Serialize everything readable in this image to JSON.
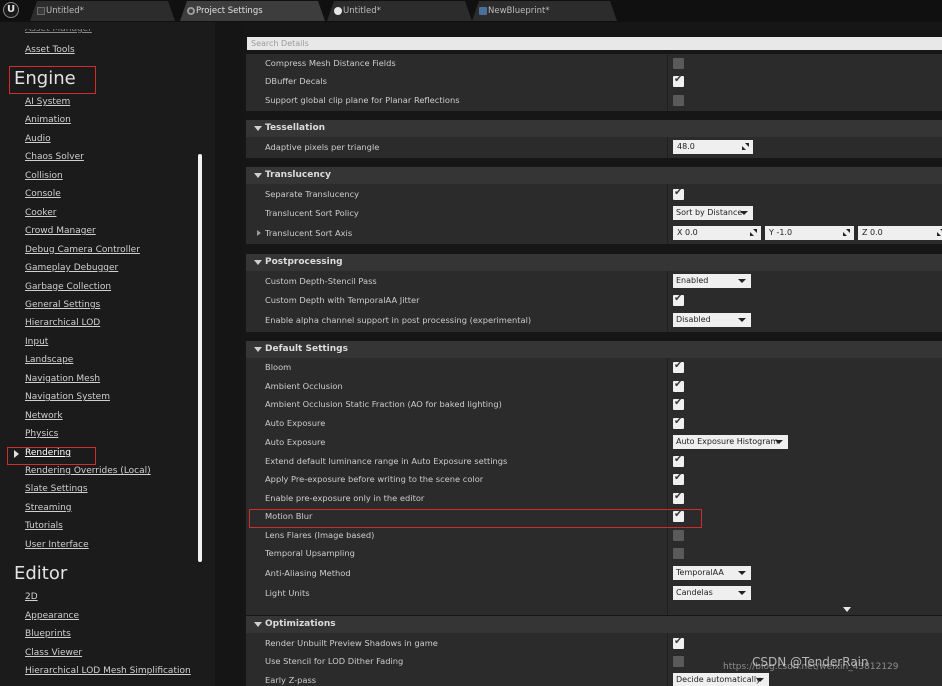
{
  "app": {
    "logo": "U",
    "tabs": [
      {
        "label": "Untitled*",
        "icon": "document-icon"
      },
      {
        "label": "Project Settings",
        "icon": "gear-icon"
      },
      {
        "label": "Untitled*",
        "icon": "level-icon"
      },
      {
        "label": "NewBlueprint*",
        "icon": "blueprint-icon"
      }
    ]
  },
  "sidebar": {
    "partial_top": "Asset Manager",
    "asset_tools": "Asset Tools",
    "engine_title": "Engine",
    "engine_items": [
      "AI System",
      "Animation",
      "Audio",
      "Chaos Solver",
      "Collision",
      "Console",
      "Cooker",
      "Crowd Manager",
      "Debug Camera Controller",
      "Gameplay Debugger",
      "Garbage Collection",
      "General Settings",
      "Hierarchical LOD",
      "Input",
      "Landscape",
      "Navigation Mesh",
      "Navigation System",
      "Network",
      "Physics",
      "Rendering",
      "Rendering Overrides (Local)",
      "Slate Settings",
      "Streaming",
      "Tutorials",
      "User Interface"
    ],
    "selected_item": "Rendering",
    "editor_title": "Editor",
    "editor_items": [
      "2D",
      "Appearance",
      "Blueprints",
      "Class Viewer",
      "Hierarchical LOD Mesh Simplification"
    ]
  },
  "details": {
    "search_placeholder": "Search Details",
    "top_rows": [
      {
        "label": "Compress Mesh Distance Fields",
        "checked": false
      },
      {
        "label": "DBuffer Decals",
        "checked": true
      },
      {
        "label": "Support global clip plane for Planar Reflections",
        "checked": false
      }
    ],
    "tessellation": {
      "title": "Tessellation",
      "adaptive_label": "Adaptive pixels per triangle",
      "adaptive_value": "48.0"
    },
    "translucency": {
      "title": "Translucency",
      "separate_label": "Separate Translucency",
      "separate_checked": true,
      "sort_policy_label": "Translucent Sort Policy",
      "sort_policy_value": "Sort by Distance",
      "sort_axis_label": "Translucent Sort Axis",
      "axis_x": "X  0.0",
      "axis_y": "Y  -1.0",
      "axis_z": "Z  0.0"
    },
    "postprocessing": {
      "title": "Postprocessing",
      "depth_stencil_label": "Custom Depth-Stencil Pass",
      "depth_stencil_value": "Enabled",
      "jitter_label": "Custom Depth with TemporalAA Jitter",
      "jitter_checked": true,
      "alpha_label": "Enable alpha channel support in post processing (experimental)",
      "alpha_value": "Disabled"
    },
    "default_settings": {
      "title": "Default Settings",
      "bloom": "Bloom",
      "ao": "Ambient Occlusion",
      "ao_static": "Ambient Occlusion Static Fraction (AO for baked lighting)",
      "auto_exposure_cb": "Auto Exposure",
      "auto_exposure_dd": "Auto Exposure",
      "auto_exposure_value": "Auto Exposure Histogram",
      "extend_lum": "Extend default luminance range in Auto Exposure settings",
      "apply_pre": "Apply Pre-exposure before writing to the scene color",
      "enable_pre": "Enable pre-exposure only in the editor",
      "motion_blur": "Motion Blur",
      "lens_flares": "Lens Flares (Image based)",
      "temporal_upsampling": "Temporal Upsampling",
      "aa_method": "Anti-Aliasing Method",
      "aa_value": "TemporalAA",
      "light_units": "Light Units",
      "light_units_value": "Candelas"
    },
    "optimizations": {
      "title": "Optimizations",
      "render_unbuilt": "Render Unbuilt Preview Shadows in game",
      "use_stencil": "Use Stencil for LOD Dither Fading",
      "early_z": "Early Z-pass",
      "early_z_value": "Decide automatically"
    }
  },
  "watermark": {
    "text": "CSDN @TenderRain",
    "url": "https://blog.csdn.net/weixin_43812129"
  },
  "colors": {
    "highlight_box": "#d02d2d",
    "panel_bg": "#2b2b2b",
    "header_bg": "#353535"
  }
}
